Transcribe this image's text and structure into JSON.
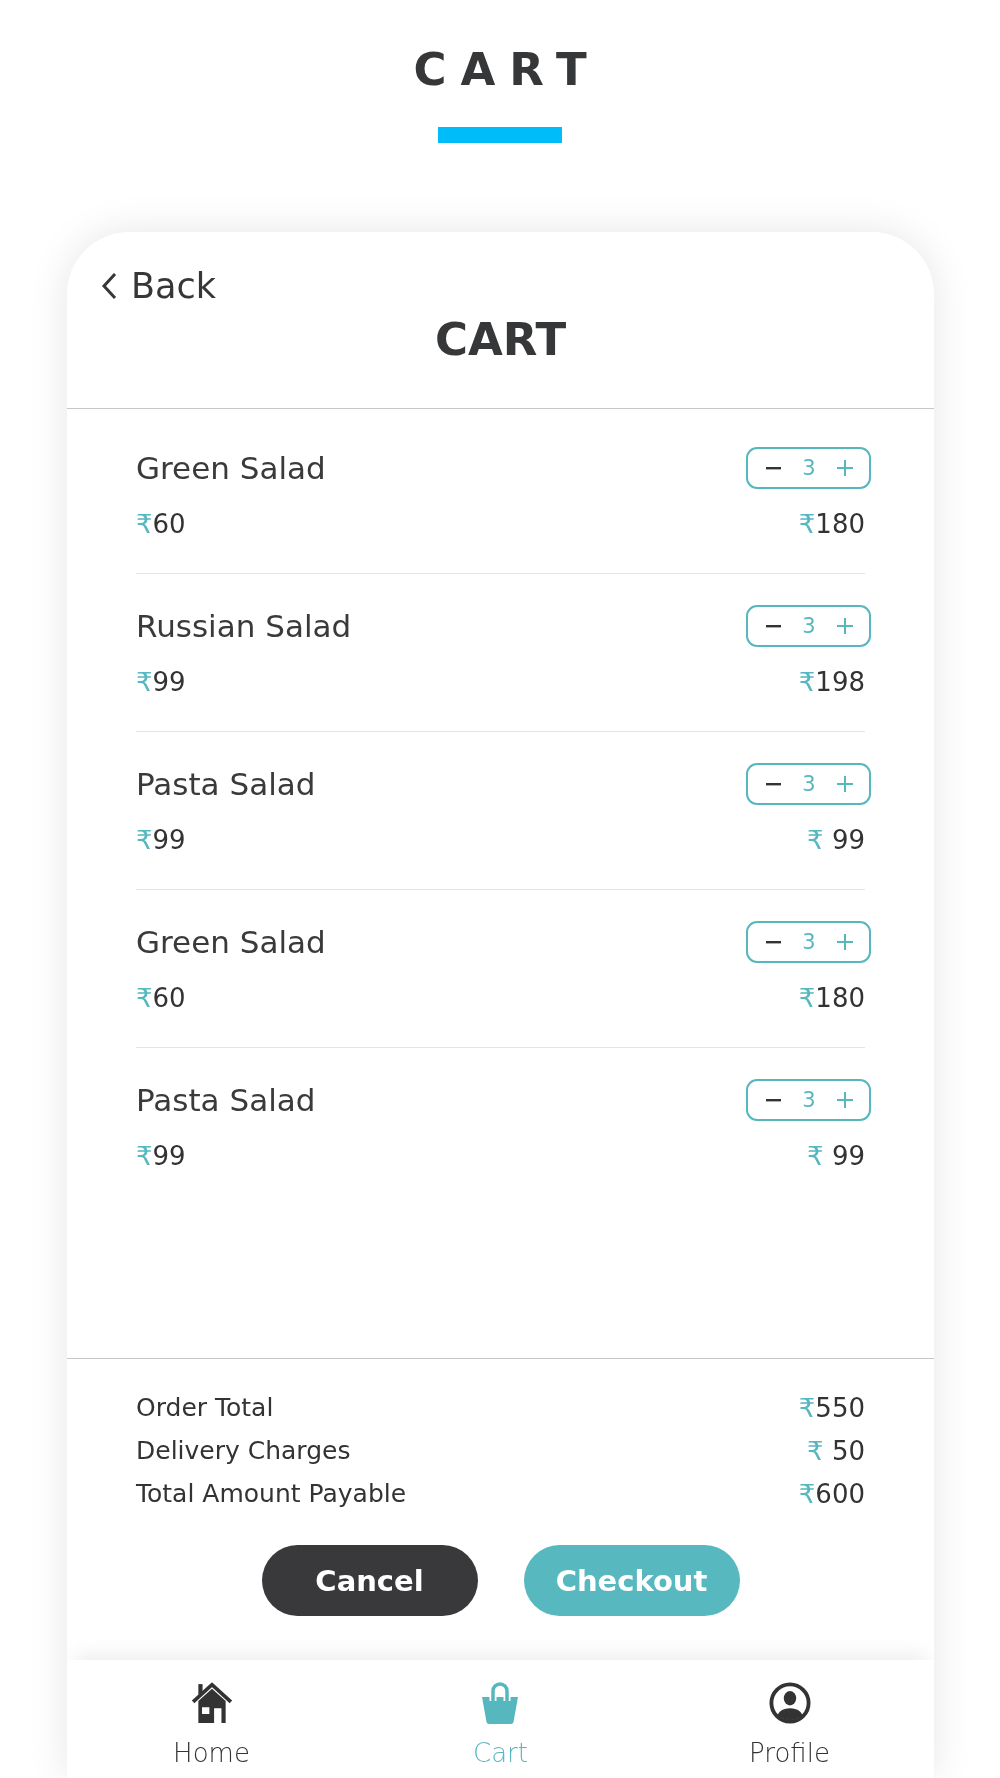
{
  "header": {
    "title": "CART"
  },
  "cart": {
    "back": {
      "label": "Back"
    },
    "title": "CART"
  },
  "items": [
    {
      "name": "Green Salad",
      "quantity": "3",
      "price": {
        "currency": "₹",
        "amount": "60"
      },
      "total": {
        "currency": "₹",
        "amount": "180"
      }
    },
    {
      "name": "Russian Salad",
      "quantity": "3",
      "price": {
        "currency": "₹",
        "amount": "99"
      },
      "total": {
        "currency": "₹",
        "amount": "198"
      }
    },
    {
      "name": "Pasta Salad",
      "quantity": "3",
      "price": {
        "currency": "₹",
        "amount": "99"
      },
      "total": {
        "currency": "₹",
        "amount": " 99"
      }
    },
    {
      "name": "Green Salad",
      "quantity": "3",
      "price": {
        "currency": "₹",
        "amount": "60"
      },
      "total": {
        "currency": "₹",
        "amount": "180"
      }
    },
    {
      "name": "Pasta Salad",
      "quantity": "3",
      "price": {
        "currency": "₹",
        "amount": "99"
      },
      "total": {
        "currency": "₹",
        "amount": " 99"
      }
    }
  ],
  "summary": [
    {
      "label": "Order Total",
      "value": {
        "currency": "₹",
        "amount": "550"
      }
    },
    {
      "label": "Delivery Charges",
      "value": {
        "currency": "₹",
        "amount": " 50"
      }
    },
    {
      "label": "Total Amount Payable",
      "value": {
        "currency": "₹",
        "amount": "600"
      }
    }
  ],
  "buttons": [
    {
      "label": "Cancel",
      "kind": "secondary"
    },
    {
      "label": "Checkout",
      "kind": "primary"
    }
  ],
  "nav": [
    {
      "label": "Home",
      "kind": "home",
      "selected": false
    },
    {
      "label": "Cart",
      "kind": "cart",
      "selected": true
    },
    {
      "label": "Profile",
      "kind": "profile",
      "selected": false
    }
  ]
}
